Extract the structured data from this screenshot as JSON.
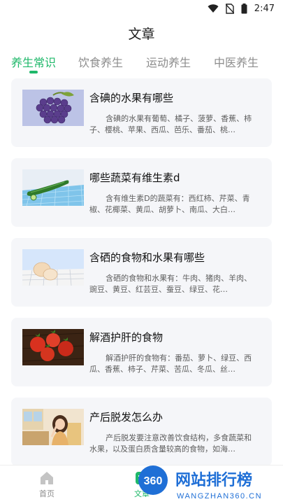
{
  "status_bar": {
    "time": "2:47",
    "icons": [
      "wifi-icon",
      "no-sim-icon",
      "battery-icon"
    ]
  },
  "page_title": "文章",
  "tabs": [
    {
      "label": "养生常识"
    },
    {
      "label": "饮食养生"
    },
    {
      "label": "运动养生"
    },
    {
      "label": "中医养生"
    }
  ],
  "articles": [
    {
      "title": "含碘的水果有哪些",
      "desc": "含碘的水果有葡萄、橘子、菠萝、香蕉、柿子、樱桃、苹果、西瓜、芭乐、番茄、桃…"
    },
    {
      "title": "哪些蔬菜有维生素d",
      "desc": "含有维生素D的蔬菜有：西红柿、芹菜、青椒、花椰菜、黄瓜、胡萝卜、南瓜、大白…"
    },
    {
      "title": "含硒的食物和水果有哪些",
      "desc": "含硒的食物和水果有：牛肉、猪肉、羊肉、豌豆、黄豆、红芸豆、蚕豆、绿豆、花…"
    },
    {
      "title": "解酒护肝的食物",
      "desc": "解酒护肝的食物有：番茄、萝卜、绿豆、西瓜、香蕉、柿子、芹菜、苦瓜、冬瓜、丝…"
    },
    {
      "title": "产后脱发怎么办",
      "desc": "产后脱发要注意改善饮食结构，多食蔬菜和水果，以及蛋白质含量较高的食物，如海…"
    }
  ],
  "bottom_nav": {
    "home_label": "首页",
    "articles_label": "文章"
  },
  "watermark": {
    "badge": "360",
    "name": "网站排行榜",
    "url": "WANGZHAN360.CN"
  },
  "colors": {
    "accent": "#1fb86a",
    "card_bg": "#f5f6f9",
    "watermark_blue": "#1f6fd6"
  }
}
